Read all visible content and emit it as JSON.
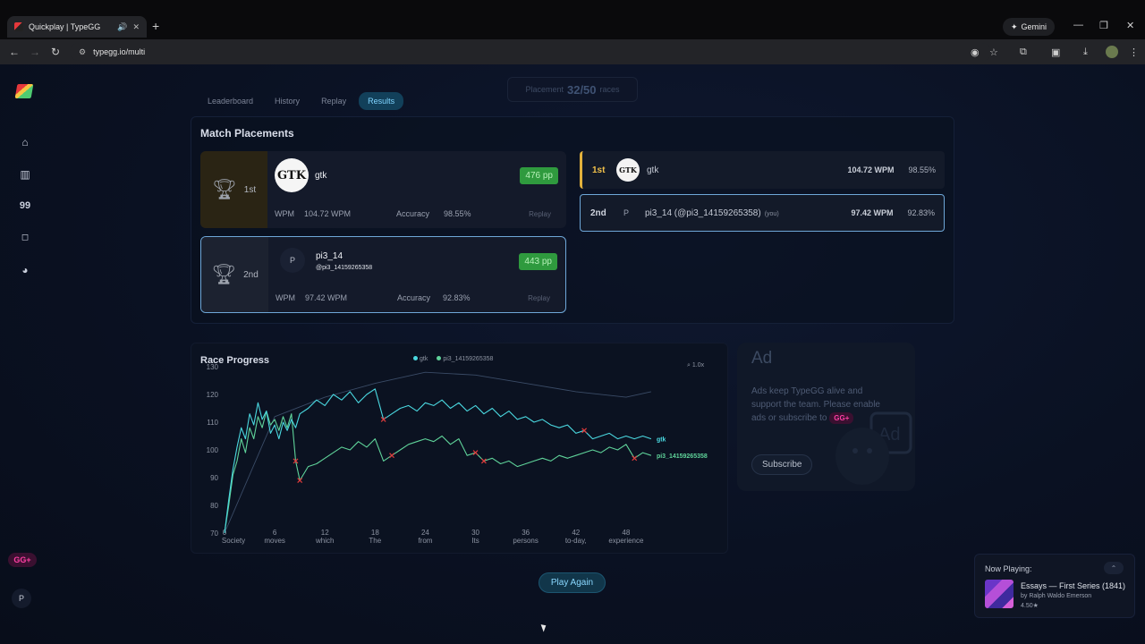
{
  "browser": {
    "tab_title": "Quickplay | TypeGG",
    "url": "typegg.io/multi",
    "gemini_label": "Gemini"
  },
  "page": {
    "tabs": [
      {
        "label": "Leaderboard",
        "active": false
      },
      {
        "label": "History",
        "active": false
      },
      {
        "label": "Replay",
        "active": false
      },
      {
        "label": "Results",
        "active": true
      }
    ],
    "placement_pill": {
      "label": "Placement",
      "count": "32/50",
      "suffix": "races"
    },
    "match_placements_title": "Match Placements",
    "placements": [
      {
        "rank": "1st",
        "name": "gtk",
        "avatar_text": "GTK",
        "handle": "",
        "pp": "476 pp",
        "wpm_label": "WPM",
        "wpm": "104.72 WPM",
        "acc_label": "Accuracy",
        "accuracy": "98.55%",
        "replay": "Replay"
      },
      {
        "rank": "2nd",
        "name": "pi3_14",
        "avatar_text": "P",
        "handle": "@pi3_14159265358",
        "pp": "443 pp",
        "wpm_label": "WPM",
        "wpm": "97.42 WPM",
        "acc_label": "Accuracy",
        "accuracy": "92.83%",
        "replay": "Replay"
      }
    ],
    "standings": [
      {
        "rank": "1st",
        "avatar_text": "GTK",
        "name": "gtk",
        "you": "",
        "wpm": "104.72 WPM",
        "accuracy": "98.55%"
      },
      {
        "rank": "2nd",
        "avatar_text": "P",
        "name": "pi3_14 (@pi3_14159265358)",
        "you": "(you)",
        "wpm": "97.42 WPM",
        "accuracy": "92.83%"
      }
    ],
    "race_progress_title": "Race Progress",
    "zoom_label": "1.0x",
    "play_again": "Play Again",
    "sidebar": {
      "gg_badge": "GG+",
      "user_initial": "P"
    }
  },
  "ad": {
    "title": "Ad",
    "text": "Ads keep TypeGG alive and support the team. Please enable ads or subscribe to",
    "badge": "GG+",
    "subscribe": "Subscribe"
  },
  "now_playing": {
    "label": "Now Playing:",
    "title": "Essays — First Series (1841)",
    "author": "by Ralph Waldo Emerson",
    "rating": "4.50★"
  },
  "chart_data": {
    "type": "line",
    "title": "Race Progress",
    "xlabel": "",
    "ylabel": "",
    "xlim": [
      0,
      54
    ],
    "ylim": [
      70,
      130
    ],
    "x_ticks": [
      0,
      6,
      12,
      18,
      24,
      30,
      36,
      42,
      48
    ],
    "x_tick_words": [
      "Society",
      "moves",
      "which",
      "The",
      "from",
      "Its",
      "persons",
      "to-day,",
      "experience"
    ],
    "y_ticks": [
      70,
      80,
      90,
      100,
      110,
      120,
      130
    ],
    "grid": false,
    "legend_position": "top",
    "series": [
      {
        "name": "gtk",
        "color": "#4ad8e0",
        "x": [
          0,
          0.5,
          1,
          1.5,
          2,
          2.5,
          3,
          3.5,
          4,
          4.5,
          5,
          5.5,
          6,
          6.5,
          7,
          7.5,
          8,
          8.5,
          9,
          10,
          11,
          12,
          13,
          14,
          15,
          16,
          17,
          18,
          19,
          20,
          21,
          22,
          23,
          24,
          25,
          26,
          27,
          28,
          29,
          30,
          31,
          32,
          33,
          34,
          35,
          36,
          37,
          38,
          39,
          40,
          41,
          42,
          43,
          44,
          45,
          46,
          47,
          48,
          49,
          50,
          51
        ],
        "y": [
          70,
          82,
          93,
          101,
          108,
          104,
          113,
          109,
          117,
          111,
          114,
          106,
          109,
          104,
          110,
          107,
          111,
          108,
          113,
          115,
          118,
          116,
          120,
          118,
          121,
          117,
          120,
          122,
          111,
          113,
          115,
          116,
          114,
          117,
          116,
          118,
          115,
          117,
          114,
          116,
          113,
          115,
          112,
          114,
          111,
          112,
          110,
          111,
          109,
          108,
          109,
          106,
          107,
          104,
          105,
          106,
          104,
          105,
          104,
          105,
          104
        ]
      },
      {
        "name": "pi3_14159265358",
        "color": "#5fd39a",
        "x": [
          0,
          0.5,
          1,
          1.5,
          2,
          2.5,
          3,
          3.5,
          4,
          4.5,
          5,
          5.5,
          6,
          6.5,
          7,
          7.5,
          8,
          8.5,
          9,
          10,
          11,
          12,
          13,
          14,
          15,
          16,
          17,
          18,
          19,
          20,
          21,
          22,
          23,
          24,
          25,
          26,
          27,
          28,
          29,
          30,
          31,
          32,
          33,
          34,
          35,
          36,
          37,
          38,
          39,
          40,
          41,
          42,
          43,
          44,
          45,
          46,
          47,
          48,
          49,
          50,
          51
        ],
        "y": [
          70,
          80,
          91,
          96,
          104,
          99,
          108,
          104,
          112,
          108,
          114,
          109,
          111,
          107,
          112,
          108,
          113,
          96,
          89,
          94,
          95,
          97,
          99,
          101,
          100,
          103,
          101,
          104,
          96,
          98,
          100,
          102,
          103,
          104,
          103,
          105,
          102,
          104,
          98,
          99,
          96,
          97,
          95,
          96,
          94,
          95,
          96,
          97,
          96,
          98,
          97,
          98,
          99,
          100,
          99,
          101,
          100,
          102,
          97,
          99,
          98
        ]
      },
      {
        "name": "",
        "color": "#3a4b66",
        "x": [
          0,
          6,
          12,
          18,
          24,
          30,
          36,
          42,
          48,
          51
        ],
        "y": [
          70,
          112,
          119,
          124,
          128,
          127,
          124,
          121,
          119,
          121
        ]
      }
    ],
    "error_markers": [
      {
        "series": "gtk",
        "x": [
          19,
          43
        ]
      },
      {
        "series": "pi3_14159265358",
        "x": [
          8.5,
          9,
          20,
          30,
          31,
          49
        ]
      }
    ]
  },
  "icons": {
    "trophy": "trophy-icon",
    "home": "home-icon",
    "stats": "bar-chart-icon",
    "quotes": "quote-icon",
    "shop": "bag-icon",
    "discord": "discord-icon"
  }
}
